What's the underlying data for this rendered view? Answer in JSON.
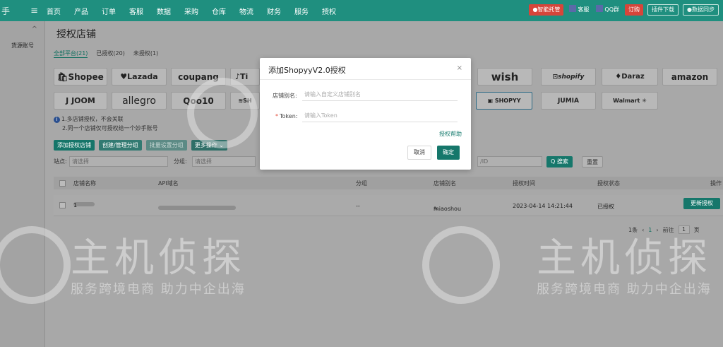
{
  "topbar": {
    "hand": "手",
    "menu_icon": "menu-icon",
    "nav": [
      "首页",
      "产品",
      "订单",
      "客服",
      "数据",
      "采购",
      "仓库",
      "物流",
      "财务",
      "服务",
      "授权"
    ],
    "right": {
      "badge_red": "●智能托管",
      "kefu": "客服",
      "qq": "QQ群",
      "order": "订购",
      "plugin": "插件下载",
      "sync": "●数据同步"
    }
  },
  "sidebar": {
    "collapse_icon": "^",
    "item": "货源账号"
  },
  "page": {
    "title": "授权店铺",
    "tabs": [
      "全部平台(21)",
      "已授权(20)",
      "未授权(1)"
    ]
  },
  "platforms": [
    {
      "name": "Shopee"
    },
    {
      "name": "Lazada"
    },
    {
      "name": "coupang"
    },
    {
      "name": "Ti"
    },
    {
      "name": "wish"
    },
    {
      "name": "shopify"
    },
    {
      "name": "Daraz"
    },
    {
      "name": "amazon"
    },
    {
      "name": "JOOM"
    },
    {
      "name": "allegro"
    },
    {
      "name": "Qoo10"
    },
    {
      "name": "SH"
    },
    {
      "name": "SHOPYY"
    },
    {
      "name": "JUMIA"
    },
    {
      "name": "Walmart"
    }
  ],
  "notes": {
    "line1": "1.多店铺授权，不会关联",
    "line2": "2.同一个店铺仅可授权给一个妙手账号"
  },
  "actions": {
    "add": "添加授权店铺",
    "create_group": "创建/管理分组",
    "batch": "批量设置分组",
    "more": "更多操作 ⌄"
  },
  "search": {
    "site_label": "站点:",
    "site_placeholder": "请选择",
    "group_label": "分组:",
    "group_placeholder": "请选择",
    "id_placeholder": "/ID",
    "search_btn": "Q 搜索",
    "reset_btn": "重置"
  },
  "table": {
    "headers": [
      "店铺名称",
      "API域名",
      "分组",
      "店铺别名",
      "授权时间",
      "授权状态",
      "操作"
    ],
    "rows": [
      {
        "name_suffix": "1",
        "group": "--",
        "alias": "miaoshou",
        "time": "2023-04-14 14:21:44",
        "status": "已授权",
        "action": "更新授权"
      }
    ]
  },
  "pager": {
    "total": "1条",
    "page": "1",
    "goto": "前往",
    "page_input": "1",
    "page_unit": "页"
  },
  "watermark": {
    "big": "主机侦探",
    "small": "服务跨境电商 助力中企出海"
  },
  "modal": {
    "title": "添加ShopyyV2.0授权",
    "close": "×",
    "shop_alias_label": "店铺别名:",
    "shop_alias_placeholder": "请输入自定义店铺别名",
    "token_label": "Token:",
    "token_placeholder": "请输入Token",
    "help": "授权帮助",
    "cancel": "取消",
    "ok": "确定"
  }
}
